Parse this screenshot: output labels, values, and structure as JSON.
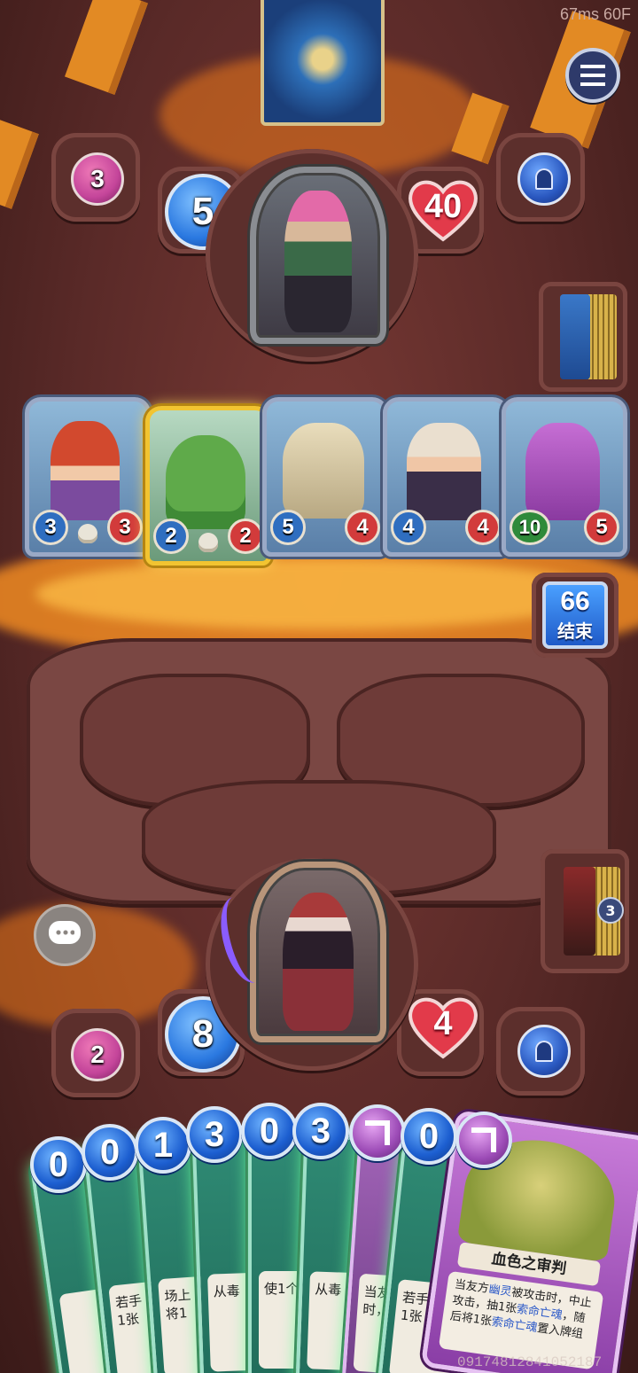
{
  "hud": {
    "perf": "67ms 60F",
    "footer_id": "09174812841052187"
  },
  "colors": {
    "lava": "#f27a1e",
    "mana": "#2a78e0",
    "health": "#e23a4a",
    "rune": "#c4459a",
    "hand_glow": "#6cff9a"
  },
  "menu": {
    "icon": "hamburger-menu-icon"
  },
  "opponent": {
    "rune_count": "3",
    "mana": "5",
    "health": "40",
    "grave_icon": "tombstone-icon"
  },
  "turn": {
    "timer": "66",
    "end_label": "结束"
  },
  "board": {
    "minions": [
      {
        "name": "horned-girl",
        "attack": "3",
        "health": "3",
        "deathrattle": true,
        "frame": "silver"
      },
      {
        "name": "green-dino",
        "attack": "2",
        "health": "2",
        "deathrattle": true,
        "frame": "gold"
      },
      {
        "name": "bone-dragon",
        "attack": "5",
        "health": "4",
        "deathrattle": false,
        "frame": "silver"
      },
      {
        "name": "demon-lady",
        "attack": "4",
        "health": "4",
        "deathrattle": false,
        "frame": "silver"
      },
      {
        "name": "purple-dragon",
        "attack": "10",
        "health": "5",
        "deathrattle": false,
        "frame": "silver"
      }
    ]
  },
  "player": {
    "rune_count": "2",
    "mana": "8",
    "health": "4",
    "deck_count": "3",
    "grave_icon": "tombstone-icon",
    "chat_icon": "chat-bubble-icon"
  },
  "hand": {
    "cards": [
      {
        "cost": "0",
        "kind": "mana",
        "text": ""
      },
      {
        "cost": "0",
        "kind": "mana",
        "text": "若手\n1张"
      },
      {
        "cost": "1",
        "kind": "mana",
        "text": "场上\n将1"
      },
      {
        "cost": "3",
        "kind": "mana",
        "text": "从毒"
      },
      {
        "cost": "0",
        "kind": "mana",
        "text": "使1个"
      },
      {
        "cost": "3",
        "kind": "mana",
        "text": "从毒"
      },
      {
        "cost": "",
        "kind": "rune",
        "text": "当友\n时，"
      },
      {
        "cost": "0",
        "kind": "mana",
        "text": "若手\n1张"
      }
    ],
    "featured": {
      "title": "血色之审判",
      "text_parts": [
        {
          "t": "当友方",
          "hl": false
        },
        {
          "t": "幽灵",
          "hl": true
        },
        {
          "t": "被攻击时，中止攻击，抽1张",
          "hl": false
        },
        {
          "t": "索命亡魂",
          "hl": true
        },
        {
          "t": "，随后将1张",
          "hl": false
        },
        {
          "t": "索命亡魂",
          "hl": true
        },
        {
          "t": "置入牌组",
          "hl": false
        }
      ]
    }
  }
}
